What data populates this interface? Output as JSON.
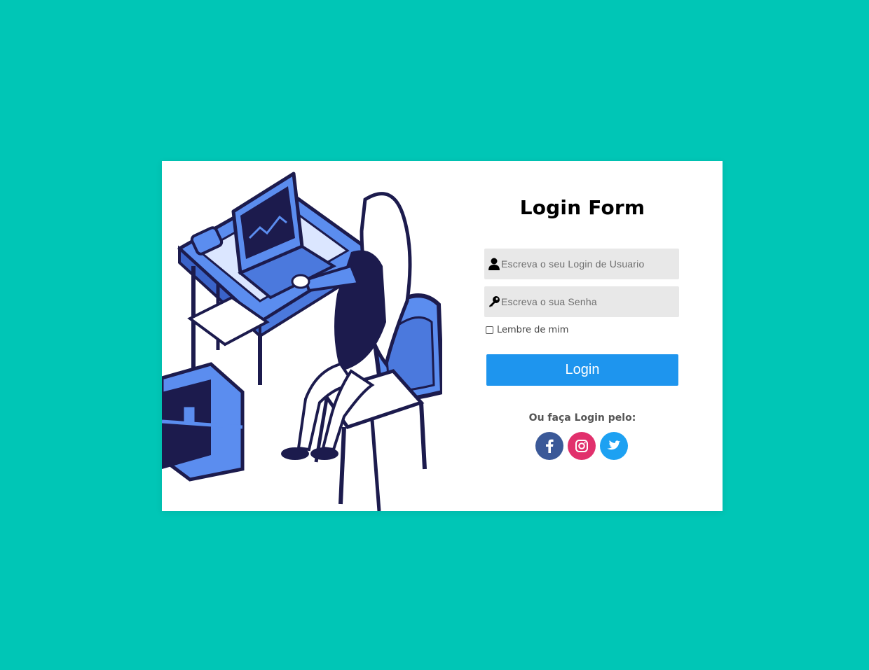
{
  "form": {
    "title": "Login Form",
    "username_placeholder": "Escreva o seu Login de Usuario",
    "password_placeholder": "Escreva o sua Senha",
    "remember_label": "Lembre de mim",
    "login_label": "Login",
    "alt_login_text": "Ou faça Login pelo:"
  },
  "social": [
    {
      "name": "facebook",
      "color": "#3b5998"
    },
    {
      "name": "instagram",
      "color": "#e1306c"
    },
    {
      "name": "twitter",
      "color": "#1da1f2"
    }
  ],
  "colors": {
    "background": "#00c6b6",
    "button": "#1e95ee",
    "illustration_primary": "#5b8def",
    "illustration_dark": "#1c1b4d"
  },
  "icons": {
    "username": "user-icon",
    "password": "key-icon"
  }
}
